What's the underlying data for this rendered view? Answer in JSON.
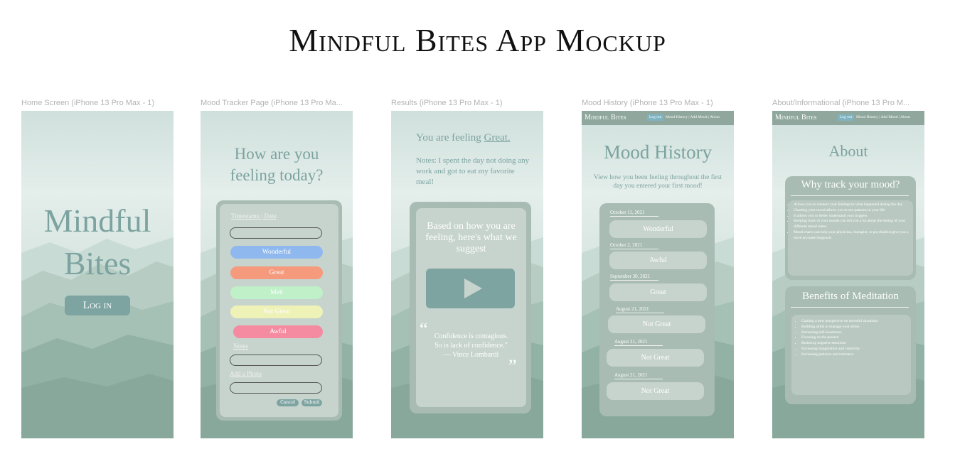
{
  "page_title": "Mindful Bites App Mockup",
  "frames": {
    "home": {
      "label": "Home Screen (iPhone 13 Pro Max - 1)",
      "title_line1": "Mindful",
      "title_line2": "Bites",
      "login_label": "Log in"
    },
    "tracker": {
      "label": "Mood Tracker Page (iPhone 13 Pro Ma...",
      "title_line1": "How are you",
      "title_line2": "feeling today?",
      "timestamp_label": "Timestamp | Date",
      "moods": [
        {
          "label": "Wonderful",
          "color": "#8fb8ef"
        },
        {
          "label": "Great",
          "color": "#f59a7d"
        },
        {
          "label": "Meh",
          "color": "#bff0c8"
        },
        {
          "label": "Not Great",
          "color": "#eef2b7"
        },
        {
          "label": "Awful",
          "color": "#f58ba0"
        }
      ],
      "notes_label": "Notes",
      "photo_label": "Add a Photo",
      "cancel_label": "Cancel",
      "submit_label": "Submit"
    },
    "results": {
      "label": "Results (iPhone 13 Pro Max - 1)",
      "feeling_prefix": "You are feeling ",
      "feeling_value": "Great.",
      "notes": "Notes: I spent the day not doing any work and got to eat my favorite meal!",
      "suggest": "Based on how you are feeling, here's what we suggest",
      "quote_line1": "Confidence is contagious.",
      "quote_line2": "So is lack of confidence.\"",
      "quote_author": "— Vince Lombardi"
    },
    "history": {
      "label": "Mood History (iPhone 13 Pro Max - 1)",
      "title": "Mood History",
      "subtitle": "View how you been feeling throughout the first day you entered your first mood!",
      "entries": [
        {
          "date": "October 11, 2021",
          "mood": "Wonderful"
        },
        {
          "date": "October 2, 2021",
          "mood": "Awful"
        },
        {
          "date": "September 30, 2021",
          "mood": "Great"
        },
        {
          "date": "August 21, 2021",
          "mood": "Not Great"
        },
        {
          "date": "August 21, 2021",
          "mood": "Not Great"
        },
        {
          "date": "August 21, 2021",
          "mood": "Not Great"
        }
      ]
    },
    "about": {
      "label": "About/Informational (iPhone 13 Pro M...",
      "title": "About",
      "why_heading": "Why track your mood?",
      "why_items": [
        "Allows you to connect your feelings to what happened during the day",
        "Charting your mood allows you to see patterns in your life",
        "It allows you to better understand your triggers",
        "Keeping track of your moods can tell you a lot about the timing of your different mood states",
        "Mood charts can help your physician, therapist, or psychiatrist give you a more accurate diagnosis"
      ],
      "benefits_heading": "Benefits of Meditation",
      "benefit_items": [
        "Gaining a new perspective on stressful situations",
        "Building skills to manage your stress",
        "Increasing self-awareness",
        "Focusing on the present",
        "Reducing negative emotions",
        "Increasing imagination and creativity",
        "Increasing patience and tolerance"
      ]
    }
  },
  "navbar": {
    "brand": "Mindful Bites",
    "logout": "Log out",
    "links": "Mood History | Add Mood | About"
  }
}
